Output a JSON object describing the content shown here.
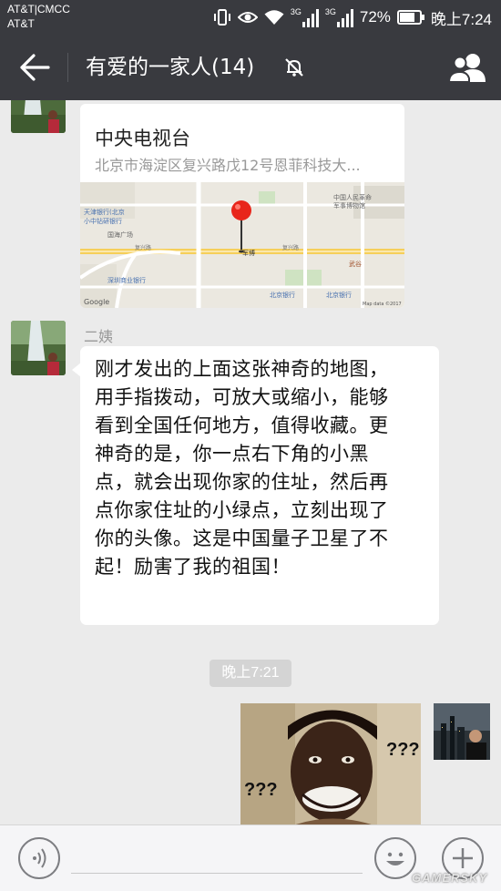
{
  "status_bar": {
    "carrier_line1": "AT&T|CMCC",
    "carrier_line2": "AT&T",
    "network_1": "3G",
    "network_2": "3G",
    "battery": "72%",
    "time": "晚上7:24"
  },
  "header": {
    "title": "有爱的一家人(14)",
    "icons": [
      "back-arrow-icon",
      "mute-bell-icon",
      "group-members-icon"
    ]
  },
  "messages": {
    "location_card": {
      "title": "中央电视台",
      "address": "北京市海淀区复兴路戊12号恩菲科技大...",
      "map_labels": [
        "天津银行(北京",
        "小中钻研银行",
        "国海广场",
        "中国人民革命",
        "军事博物馆",
        "军博",
        "复兴路",
        "复兴路",
        "武谷",
        "深圳商业银行",
        "北京银行",
        "北京银行"
      ],
      "map_footer_left": "Google",
      "map_footer_right": "Map data ©2017"
    },
    "text_message": {
      "sender": "二姨",
      "lines": [
        "刚才发出的上面这张神奇的地图，",
        "用手指拨动，可放大或缩小，能够",
        "看到全国任何地方，值得收藏。更",
        "神奇的是，你一点右下角的小黑",
        "点，就会出现你家的住址，然后再",
        "点你家住址的小绿点，立刻出现了",
        "你的头像。这是中国量子卫星了不",
        "起！励害了我的祖国！"
      ]
    },
    "timestamp": "晚上7:21",
    "meme": {
      "text_right": "???",
      "text_left": "???"
    }
  },
  "input_bar": {
    "icons": [
      "voice-icon",
      "emoji-icon",
      "plus-icon"
    ]
  },
  "watermark": "GAMERSKY",
  "colors": {
    "bar": "#393a3f",
    "chat_bg": "#ebebeb",
    "pin": "#e8261b"
  }
}
